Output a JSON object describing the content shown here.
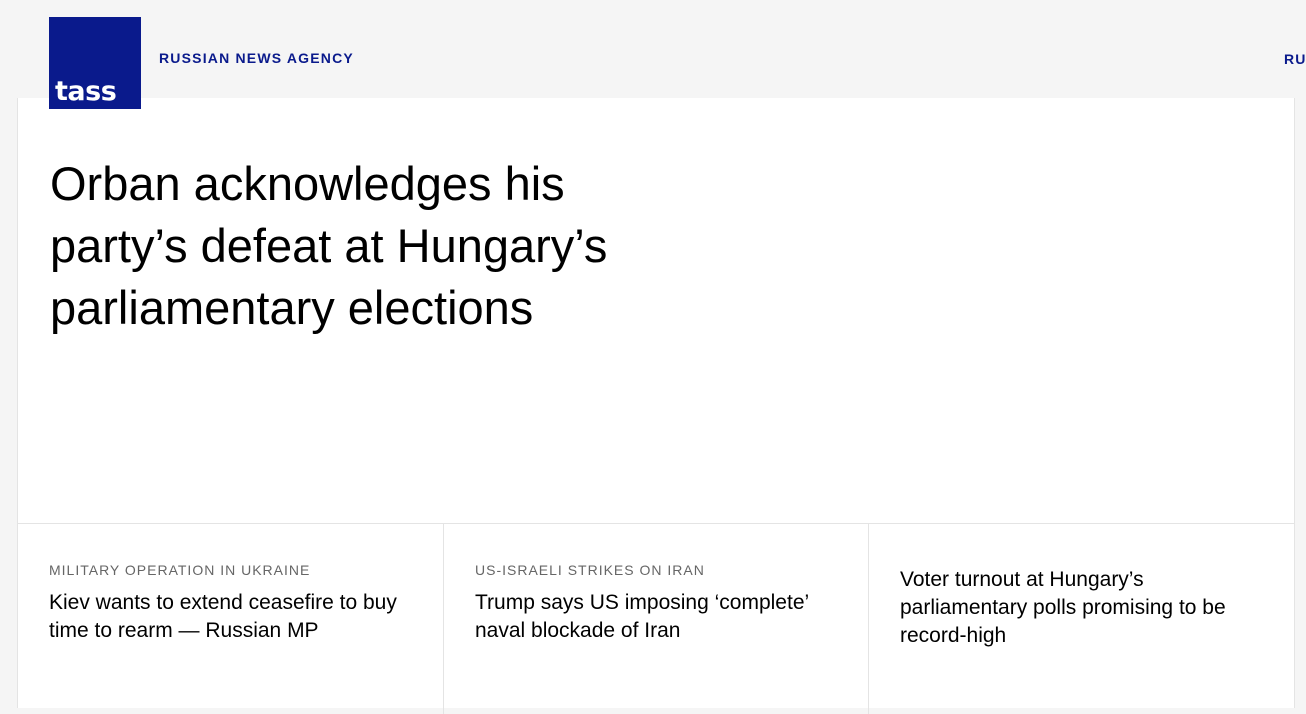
{
  "header": {
    "logo_text": "tass",
    "tagline": "RUSSIAN NEWS AGENCY",
    "lang_switch": "RU"
  },
  "main": {
    "headline": "Orban acknowledges his party’s defeat at Hungary’s parliamentary elections"
  },
  "news": [
    {
      "rubric": "MILITARY OPERATION IN UKRAINE",
      "title": "Kiev wants to extend ceasefire to buy time to rearm — Russian MP"
    },
    {
      "rubric": "US-ISRAELI STRIKES ON IRAN",
      "title": "Trump says US imposing ‘complete’ naval blockade of Iran"
    },
    {
      "rubric": "",
      "title": "Voter turnout at Hungary’s parliamentary polls promising to be record-high"
    }
  ],
  "colors": {
    "brand": "#0a1a8c",
    "page_background": "#f5f5f5",
    "card_background": "#ffffff",
    "rubric_text": "#666666"
  }
}
